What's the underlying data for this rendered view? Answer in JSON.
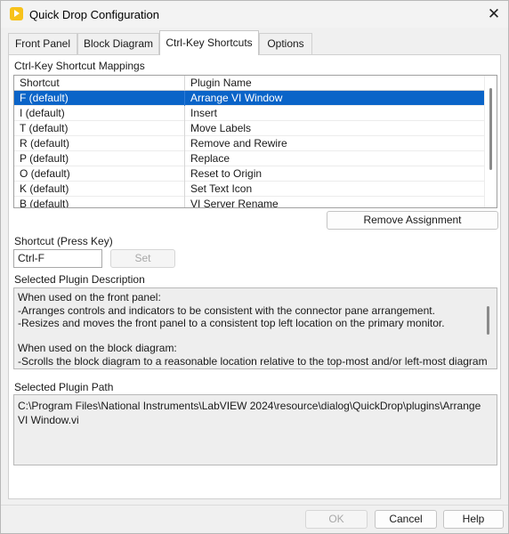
{
  "window": {
    "title": "Quick Drop Configuration"
  },
  "tabs": [
    {
      "label": "Front Panel"
    },
    {
      "label": "Block Diagram"
    },
    {
      "label": "Ctrl-Key Shortcuts"
    },
    {
      "label": "Options"
    }
  ],
  "active_tab": "Ctrl-Key Shortcuts",
  "mappings": {
    "section_label": "Ctrl-Key Shortcut Mappings",
    "columns": [
      "Shortcut",
      "Plugin Name"
    ],
    "rows": [
      {
        "shortcut": "F (default)",
        "plugin": "Arrange VI Window",
        "selected": true
      },
      {
        "shortcut": "I (default)",
        "plugin": "Insert"
      },
      {
        "shortcut": "T (default)",
        "plugin": "Move Labels"
      },
      {
        "shortcut": "R (default)",
        "plugin": "Remove and Rewire"
      },
      {
        "shortcut": "P (default)",
        "plugin": "Replace"
      },
      {
        "shortcut": "O (default)",
        "plugin": "Reset to Origin"
      },
      {
        "shortcut": "K (default)",
        "plugin": "Set Text Icon"
      },
      {
        "shortcut": "B (default)",
        "plugin": "VI Server Rename"
      }
    ],
    "remove_button": "Remove Assignment"
  },
  "shortcut_input": {
    "label": "Shortcut (Press Key)",
    "value": "Ctrl-F",
    "set_button": "Set"
  },
  "description": {
    "label": "Selected Plugin Description",
    "lines": [
      "When used on the front panel:",
      "-Arranges controls and indicators to be consistent with the connector pane arrangement.",
      "-Resizes and moves the front panel to a consistent top left location on the primary monitor.",
      "",
      "When used on the block diagram:",
      "-Scrolls the block diagram to a reasonable location relative to the top-most and/or left-most diagram"
    ]
  },
  "path": {
    "label": "Selected Plugin Path",
    "value": "C:\\Program Files\\National Instruments\\LabVIEW 2024\\resource\\dialog\\QuickDrop\\plugins\\Arrange VI Window.vi"
  },
  "footer": {
    "ok": "OK",
    "cancel": "Cancel",
    "help": "Help"
  },
  "colors": {
    "selection": "#0a64c8",
    "app_icon": "#f7c21b"
  }
}
